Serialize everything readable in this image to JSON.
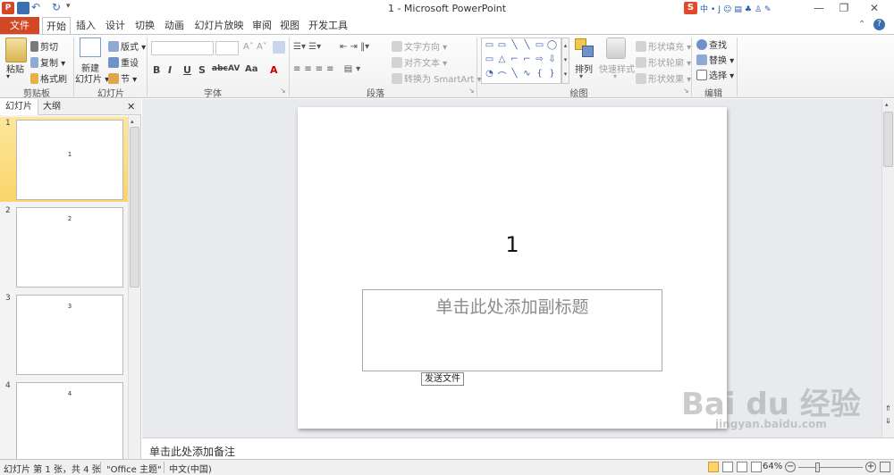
{
  "window": {
    "title": "1 - Microsoft PowerPoint",
    "help_glyph": "?",
    "controls": {
      "minimize": "—",
      "restore": "❐",
      "close": "✕"
    },
    "collapse_glyph": "⌃",
    "help_icon": "?"
  },
  "quick_access": {
    "app_icon": "P",
    "undo": "↶",
    "redo": "↻",
    "customize": "▾"
  },
  "ime_bar": {
    "logo": "S",
    "items": [
      "中",
      "•",
      "J",
      "☺",
      "▤",
      "♣",
      "♙",
      "✎"
    ]
  },
  "tabs": [
    "文件",
    "开始",
    "插入",
    "设计",
    "切换",
    "动画",
    "幻灯片放映",
    "审阅",
    "视图",
    "开发工具"
  ],
  "ribbon": {
    "clipboard": {
      "label": "剪贴板",
      "paste": "粘贴",
      "cut": "剪切",
      "copy": "复制",
      "format_painter": "格式刷"
    },
    "slides": {
      "label": "幻灯片",
      "new_slide_line1": "新建",
      "new_slide_line2": "幻灯片",
      "layout": "版式",
      "reset": "重设",
      "section": "节"
    },
    "font": {
      "label": "字体",
      "buttons": [
        "B",
        "I",
        "U",
        "S",
        "abc",
        "AV",
        "Aa",
        "A"
      ]
    },
    "paragraph": {
      "label": "段落",
      "text_direction": "文字方向",
      "align_text": "对齐文本",
      "convert_smartart": "转换为 SmartArt"
    },
    "drawing": {
      "label": "绘图",
      "arrange": "排列",
      "quick_styles": "快速样式",
      "shape_fill": "形状填充",
      "shape_outline": "形状轮廓",
      "shape_effects": "形状效果",
      "shapes": [
        "▭",
        "▭",
        "╲",
        "╲",
        "▭",
        "◯",
        "▭",
        "△",
        "⌐",
        "⌐",
        "⇨",
        "⇩",
        "◔",
        "⌒",
        "╲",
        "∿",
        "{",
        "}"
      ]
    },
    "editing": {
      "label": "编辑",
      "find": "查找",
      "replace": "替换",
      "select": "选择"
    }
  },
  "left_pane": {
    "tabs": [
      "幻灯片",
      "大纲"
    ],
    "close": "✕",
    "slides": [
      {
        "num": "1",
        "text": "1"
      },
      {
        "num": "2",
        "text": "2"
      },
      {
        "num": "3",
        "text": "3"
      },
      {
        "num": "4",
        "text": "4"
      }
    ]
  },
  "slide": {
    "title": "1",
    "subtitle_placeholder": "单击此处添加副标题",
    "tooltip": "发送文件"
  },
  "notes": {
    "placeholder": "单击此处添加备注"
  },
  "status": {
    "slide_info": "幻灯片 第 1 张，共 4 张",
    "theme": "\"Office 主题\"",
    "language": "中文(中国)",
    "zoom": "64%",
    "minus": "−",
    "plus": "+"
  },
  "watermark": {
    "logo": "Bai du 经验",
    "url": "jingyan.baidu.com"
  }
}
